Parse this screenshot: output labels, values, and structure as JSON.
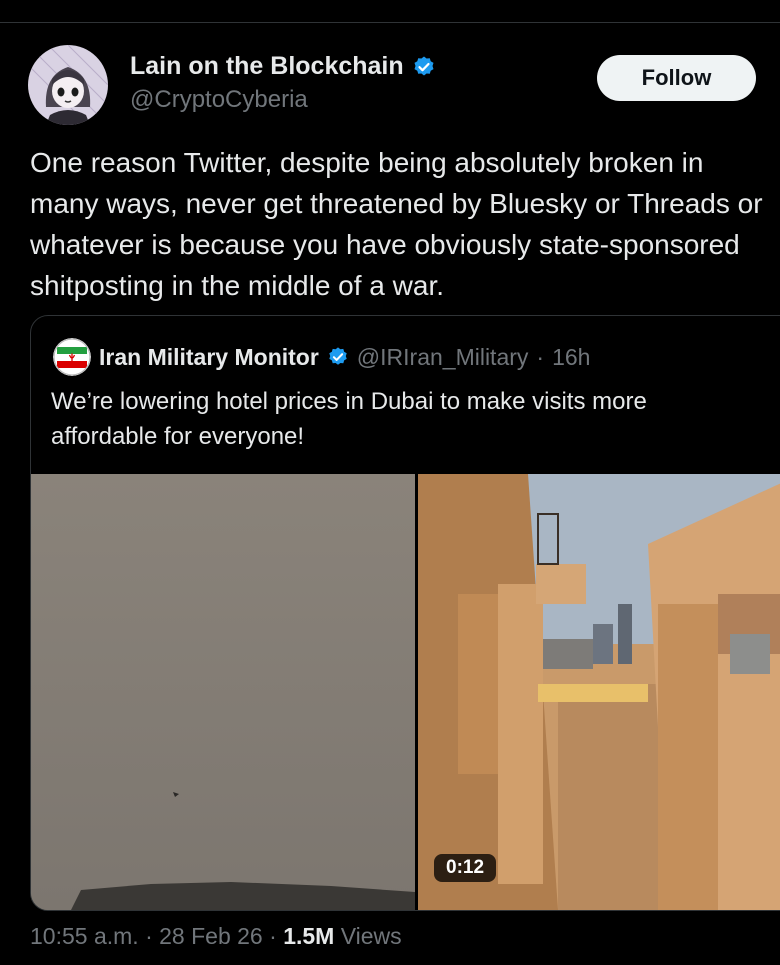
{
  "author": {
    "display_name": "Lain on the Blockchain",
    "handle": "@CryptoCyberia",
    "verified": true
  },
  "follow_button": {
    "label": "Follow"
  },
  "tweet": {
    "text": "One reason Twitter, despite being absolutely broken in many ways, never get threatened by Bluesky or Threads or whatever is because you have obviously state-sponsored shitposting in the middle of a war."
  },
  "quoted_tweet": {
    "display_name": "Iran Military Monitor",
    "handle": "@IRIran_Military",
    "separator": "·",
    "time": "16h",
    "text": "We’re lowering hotel prices in Dubai to make visits more affordable for everyone!",
    "video_duration": "0:12"
  },
  "meta": {
    "time": "10:55 a.m.",
    "separator": "·",
    "date": "28 Feb 26",
    "views_count": "1.5M",
    "views_label": "Views"
  },
  "colors": {
    "background": "#000000",
    "verified_badge": "#1d9bf0",
    "secondary_text": "#71767b",
    "follow_button_bg": "#eff3f4"
  }
}
